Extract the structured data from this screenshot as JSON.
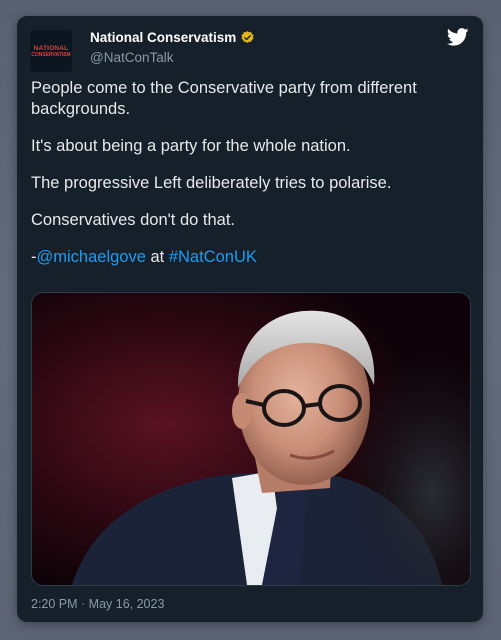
{
  "account": {
    "avatar_line1": "NATIONAL",
    "avatar_line2": "CONSERVATISM",
    "display_name": "National Conservatism",
    "handle": "@NatConTalk"
  },
  "tweet": {
    "paragraphs": [
      "People come to the Conservative party from different backgrounds.",
      "It's about being a party for the whole nation.",
      "The progressive Left deliberately tries to polarise.",
      "Conservatives don't do that."
    ],
    "attribution_prefix": "-",
    "mention": "@michaelgove",
    "attribution_middle": " at ",
    "hashtag": "#NatConUK"
  },
  "timestamp": "2:20 PM · May 16, 2023",
  "icons": {
    "verified": "verified-badge-icon",
    "platform": "twitter-bird-icon"
  },
  "colors": {
    "card_bg": "#15202b",
    "link": "#1d9bf0",
    "verified_gold": "#e2b719",
    "twitter_icon": "#ffffff"
  }
}
